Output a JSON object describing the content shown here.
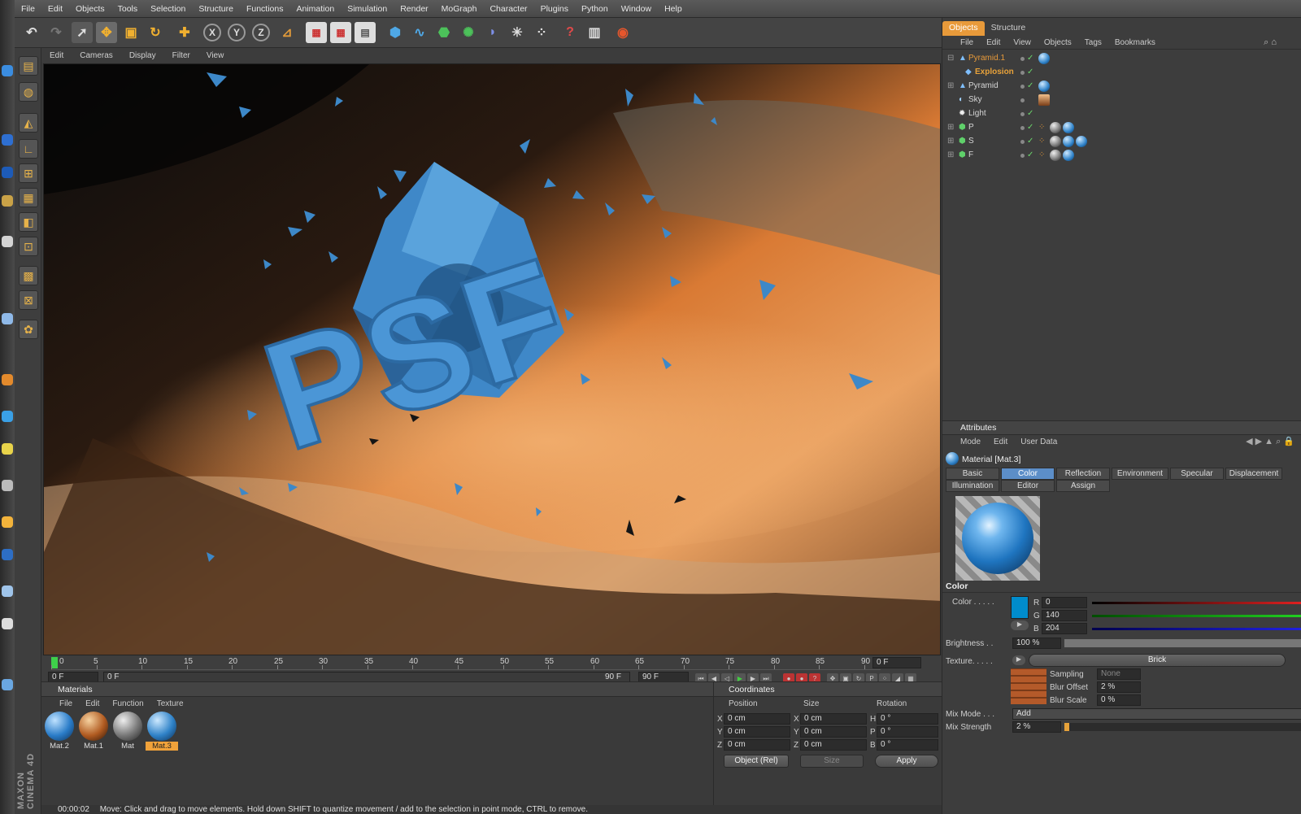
{
  "menubar": [
    "File",
    "Edit",
    "Objects",
    "Tools",
    "Selection",
    "Structure",
    "Functions",
    "Animation",
    "Simulation",
    "Render",
    "MoGraph",
    "Character",
    "Plugins",
    "Python",
    "Window",
    "Help"
  ],
  "viewport": {
    "menu": [
      "Edit",
      "Cameras",
      "Display",
      "Filter",
      "View"
    ],
    "logo_text": "PSF"
  },
  "timeline": {
    "ticks": [
      "0",
      "5",
      "10",
      "15",
      "20",
      "25",
      "30",
      "35",
      "40",
      "45",
      "50",
      "55",
      "60",
      "65",
      "70",
      "75",
      "80",
      "85",
      "90"
    ],
    "current_frame": "0 F",
    "start_field": "0 F",
    "range_start": "0 F",
    "range_end": "90 F",
    "end_field": "90 F"
  },
  "materials": {
    "title": "Materials",
    "menu": [
      "File",
      "Edit",
      "Function",
      "Texture"
    ],
    "items": [
      {
        "label": "Mat.2",
        "selected": false
      },
      {
        "label": "Mat.1",
        "selected": false
      },
      {
        "label": "Mat",
        "selected": false
      },
      {
        "label": "Mat.3",
        "selected": true
      }
    ]
  },
  "coordinates": {
    "title": "Coordinates",
    "headers": {
      "position": "Position",
      "size": "Size",
      "rotation": "Rotation"
    },
    "rows": [
      {
        "axis": "X",
        "pos": "0 cm",
        "saxis": "X",
        "size": "0 cm",
        "raxis": "H",
        "rot": "0 °"
      },
      {
        "axis": "Y",
        "pos": "0 cm",
        "saxis": "Y",
        "size": "0 cm",
        "raxis": "P",
        "rot": "0 °"
      },
      {
        "axis": "Z",
        "pos": "0 cm",
        "saxis": "Z",
        "size": "0 cm",
        "raxis": "B",
        "rot": "0 °"
      }
    ],
    "mode_select": "Object (Rel)",
    "size_select": "Size",
    "apply": "Apply"
  },
  "status": {
    "time": "00:00:02",
    "message": "Move: Click and drag to move elements. Hold down SHIFT to quantize movement / add to the selection in point mode, CTRL to remove."
  },
  "objects": {
    "tabs": [
      "Objects",
      "Structure"
    ],
    "menu": [
      "File",
      "Edit",
      "View",
      "Objects",
      "Tags",
      "Bookmarks"
    ],
    "tree": [
      {
        "name": "Pyramid.1",
        "color": "#e89a3a"
      },
      {
        "name": "Explosion",
        "color": "#e8a23a"
      },
      {
        "name": "Pyramid",
        "color": "#d6d6d6"
      },
      {
        "name": "Sky",
        "color": "#d6d6d6"
      },
      {
        "name": "Light",
        "color": "#d6d6d6"
      },
      {
        "name": "P",
        "color": "#d6d6d6"
      },
      {
        "name": "S",
        "color": "#d6d6d6"
      },
      {
        "name": "F",
        "color": "#d6d6d6"
      }
    ]
  },
  "attributes": {
    "title": "Attributes",
    "menu": [
      "Mode",
      "Edit",
      "User Data"
    ],
    "material_name": "Material [Mat.3]",
    "tabs_row1": [
      "Basic",
      "Color",
      "Reflection",
      "Environment",
      "Specular",
      "Displacement"
    ],
    "tabs_row2": [
      "Illumination",
      "Editor",
      "Assign"
    ],
    "active_tab": "Color",
    "section": "Color",
    "color_label": "Color . . . . .",
    "r_label": "R",
    "r_value": "0",
    "g_label": "G",
    "g_value": "140",
    "b_label": "B",
    "b_value": "204",
    "swatch": "#008ccc",
    "brightness_label": "Brightness . .",
    "brightness_value": "100 %",
    "texture_label": "Texture. . . . .",
    "texture_name": "Brick",
    "sampling_label": "Sampling",
    "sampling_value": "None",
    "blur_offset_label": "Blur Offset",
    "blur_offset_value": "2 %",
    "blur_scale_label": "Blur Scale",
    "blur_scale_value": "0 %",
    "mix_mode_label": "Mix Mode . . .",
    "mix_mode_value": "Add",
    "mix_strength_label": "Mix Strength",
    "mix_strength_value": "2 %"
  },
  "branding": "MAXON CINEMA 4D"
}
